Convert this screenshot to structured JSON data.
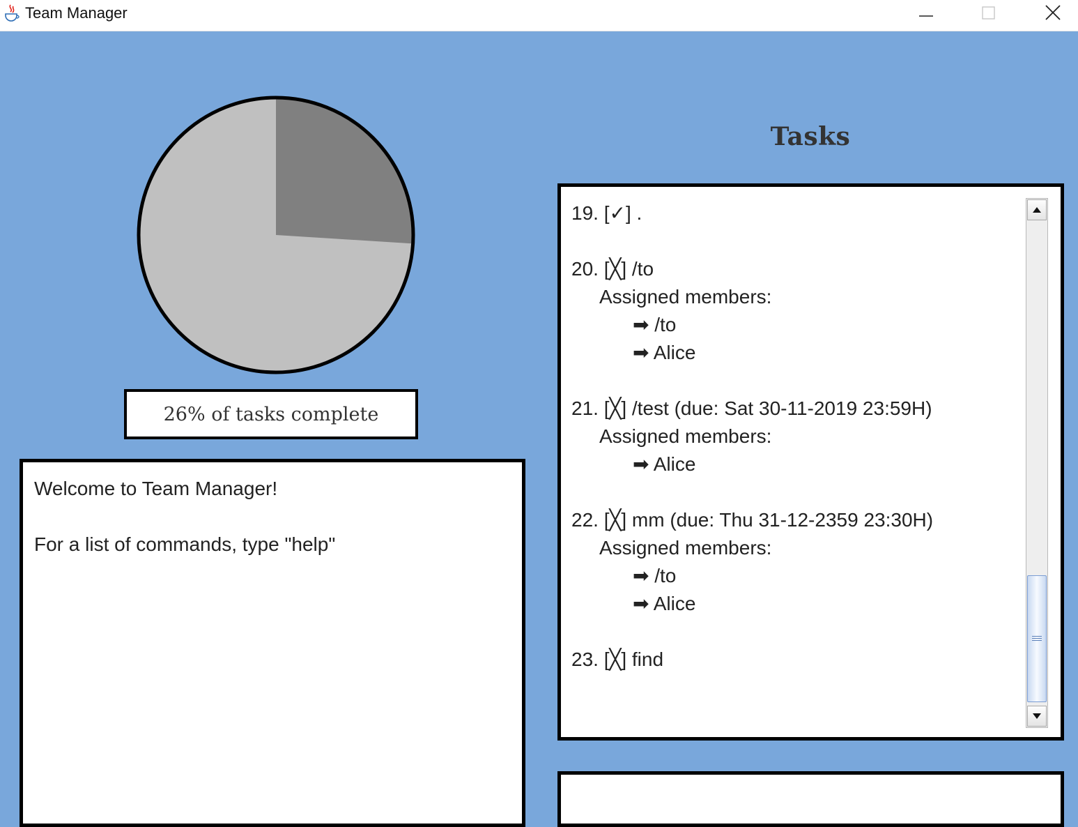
{
  "window": {
    "title": "Team Manager",
    "minimize": "—",
    "maximize": "☐",
    "close": "✕"
  },
  "progress": {
    "fraction_complete": 0.26,
    "label": "26% of tasks complete",
    "colors": {
      "complete": "#808080",
      "incomplete": "#c0c0c0",
      "border": "#000000"
    }
  },
  "console": {
    "lines": [
      "Welcome to Team Manager!",
      "",
      "For a list of commands, type \"help\""
    ]
  },
  "tasks": {
    "heading": "Tasks",
    "items": [
      {
        "header": "19. [✓] .",
        "members_label": "",
        "members": []
      },
      {
        "header": "20. [╳] /to",
        "members_label": "Assigned members:",
        "members": [
          "➡ /to",
          "➡ Alice"
        ]
      },
      {
        "header": "21. [╳] /test (due: Sat 30-11-2019 23:59H)",
        "members_label": "Assigned members:",
        "members": [
          "➡ Alice"
        ]
      },
      {
        "header": "22. [╳] mm (due: Thu 31-12-2359 23:30H)",
        "members_label": "Assigned members:",
        "members": [
          "➡ /to",
          "➡ Alice"
        ]
      },
      {
        "header": "23. [╳] find",
        "members_label": "",
        "members": []
      }
    ]
  },
  "command_input": {
    "value": ""
  },
  "theme": {
    "background": "#79a7db"
  }
}
